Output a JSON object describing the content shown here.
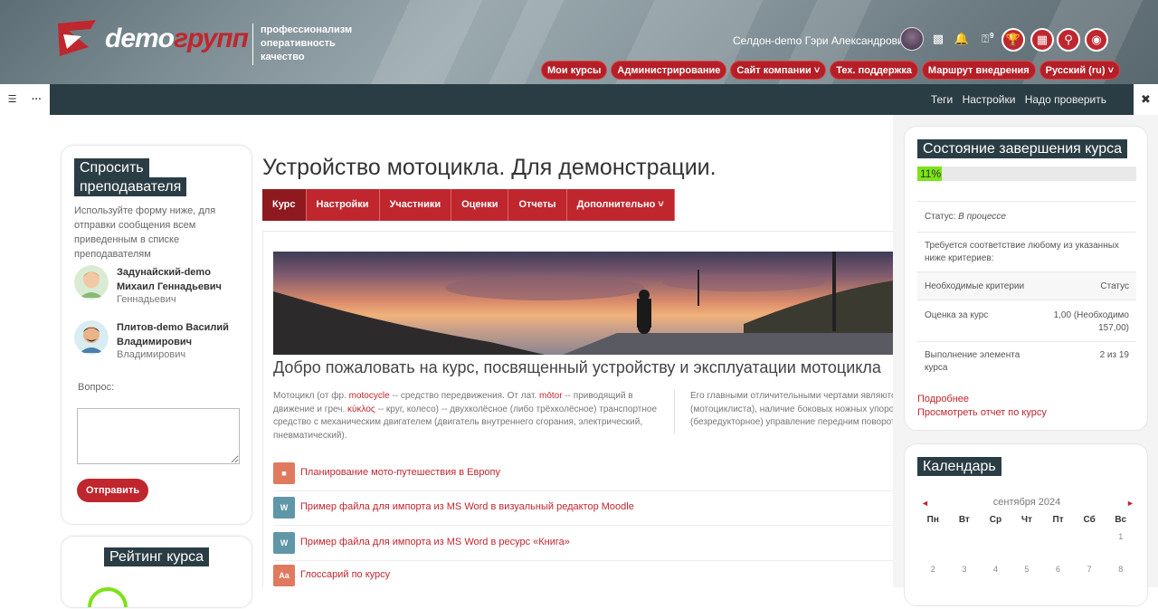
{
  "header": {
    "logo_text_white": "demo",
    "logo_text_red": "групп",
    "slogan": [
      "профессионализм",
      "оперативность",
      "качество"
    ],
    "user_name": "Селдон-demo Гэри Александрович",
    "help_badge": "9",
    "nav": [
      "Мои курсы",
      "Администрирование",
      "Сайт компании",
      "Тех. поддержка",
      "Маршрут внедрения",
      "Русский (ru)"
    ],
    "colors": {
      "accent": "#c0262e",
      "dark": "#2b3d44",
      "progress": "#7be316"
    }
  },
  "toolbar": {
    "links": [
      "Теги",
      "Настройки",
      "Надо проверить"
    ]
  },
  "ask_teacher": {
    "title_line1": "Спросить",
    "title_line2": "преподавателя",
    "description": "Используйте форму ниже, для отправки сообщения всем приведенным в списке преподавателям",
    "teachers": [
      {
        "name1": "Задунайский-demo",
        "name2": "Михаил Геннадьевич",
        "sub": "Геннадьевич"
      },
      {
        "name1": "Плитов-demo Василий",
        "name2": "Владимирович",
        "sub": "Владимирович"
      }
    ],
    "question_label": "Вопрос:",
    "send_label": "Отправить"
  },
  "rating": {
    "title": "Рейтинг курса"
  },
  "course": {
    "title": "Устройство мотоцикла. Для демонстрации.",
    "tabs": [
      "Курс",
      "Настройки",
      "Участники",
      "Оценки",
      "Отчеты",
      "Дополнительно"
    ],
    "welcome": "Добро пожаловать на курс, посвященный устройству и эксплуатации мотоцикла",
    "intro_a": "Мотоцикл (от фр. ",
    "intro_b": "motocycle",
    "intro_c": " -- средство передвижения. От лат. ",
    "intro_d": "mōtor",
    "intro_e": " -- приводящий в движение и греч. ",
    "intro_f": "κύκλος",
    "intro_g": " -- круг, колесо) -- двухколёсное (либо трёхколёсное) транспортное средство с механическим двигателем (двигатель внутреннего сгорания, электрический, пневматический).",
    "intro2": "Его главными отличительными чертами являются: (мотоциклиста), наличие боковых ножных упоров, (безредукторное) управление передним поворотным",
    "activities": [
      {
        "label": "Планирование мото-путешествия в Европу",
        "icon": "forum-icon",
        "color": "#e07a5f"
      },
      {
        "label": "Пример файла для импорта из MS Word в визуальный редактор Moodle",
        "icon": "word-file-icon",
        "color": "#5f96a8"
      },
      {
        "label": "Пример файла для импорта из MS Word в ресурс «Книга»",
        "icon": "book-file-icon",
        "color": "#5f96a8"
      },
      {
        "label": "Глоссарий по курсу",
        "icon": "glossary-icon",
        "color": "#e07a5f"
      }
    ]
  },
  "completion": {
    "title": "Состояние завершения курса",
    "progress_text": "11%",
    "progress_value": 0.11,
    "status_label": "Статус:",
    "status_value": "В процессе",
    "requirement": "Требуется соответствие любому из указанных ниже критериев:",
    "col_criteria": "Необходимые критерии",
    "col_status": "Статус",
    "rows": [
      {
        "criteria": "Оценка за курс",
        "status": "1,00 (Необходимо 157,00)"
      },
      {
        "criteria": "Выполнение элемента курса",
        "status": "2 из 19"
      }
    ],
    "link_more": "Подробнее",
    "link_report": "Просмотреть отчет по курсу"
  },
  "calendar": {
    "title": "Календарь",
    "month": "сентября 2024",
    "prev": "◄",
    "next": "►",
    "days": [
      "Пн",
      "Вт",
      "Ср",
      "Чт",
      "Пт",
      "Сб",
      "Вс"
    ],
    "week1": [
      "",
      "",
      "",
      "",
      "",
      "",
      "1"
    ],
    "week2": [
      "2",
      "3",
      "4",
      "5",
      "6",
      "7",
      "8"
    ]
  }
}
